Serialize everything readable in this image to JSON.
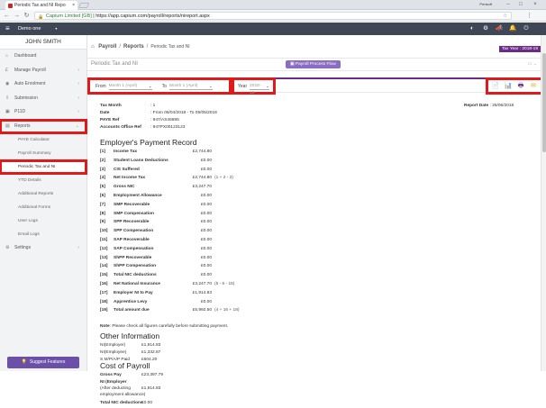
{
  "browser": {
    "tab_title": "Periodic Tax and NI Repo",
    "profile": "Pensoft",
    "url_secure": "Capium Limited [GB]",
    "url_path": "https://app.capium.com/payroll/reports/nireport.aspx"
  },
  "app": {
    "company": "Demo one",
    "tax_year": "Tax Year : 2018-19"
  },
  "sidebar": {
    "username": "JOHN SMITH",
    "items": [
      {
        "label": "Dashboard",
        "icon": "dashboard-icon"
      },
      {
        "label": "Manage Payroll",
        "icon": "payroll-icon"
      },
      {
        "label": "Auto Enrolment",
        "icon": "enrolment-icon"
      },
      {
        "label": "Submission",
        "icon": "submission-icon"
      },
      {
        "label": "P11D",
        "icon": "p11d-icon"
      },
      {
        "label": "Reports",
        "icon": "reports-icon"
      }
    ],
    "sub_items": [
      "PAYE Calculator",
      "Payroll Summary",
      "Periodic Tax and NI",
      "YTD Details",
      "Additional Reports",
      "Additional Forms",
      "User Logs",
      "Email Logs"
    ],
    "settings": "Settings",
    "suggest": "Suggest Features"
  },
  "header": {
    "crumb_payroll": "Payroll",
    "crumb_reports": "Reports",
    "crumb_current": "Periodic Tax and NI",
    "page_title": "Periodic Tax and NI",
    "process_flow": "Payroll Process Flow"
  },
  "filters": {
    "from_label": "From",
    "from_value": "Month 1 (April)",
    "to_label": "To",
    "to_value": "Month 1 (April)",
    "year_label": "Year",
    "year_value": "2018-19"
  },
  "report": {
    "tax_month_label": "Tax Month",
    "tax_month": "1",
    "date_label": "Date",
    "date_value": "From 06/04/2018 - To 05/05/2018",
    "paye_label": "PAYE Ref",
    "paye_value": "947/AS45695",
    "aor_label": "Accounts Office Ref",
    "aor_value": "947PX00123123",
    "report_date_label": "Report Date",
    "report_date": "25/06/2018",
    "epr_title": "Employer's Payment Record",
    "rows": [
      {
        "num": "[1]",
        "label": "Income Tax",
        "value": "£2,744.80",
        "note": ""
      },
      {
        "num": "[2]",
        "label": "Student Loans Deductions",
        "value": "£0.00",
        "note": ""
      },
      {
        "num": "[3]",
        "label": "CIS Suffered",
        "value": "£0.00",
        "note": ""
      },
      {
        "num": "[4]",
        "label": "Net Income Tax",
        "value": "£2,744.80",
        "note": "(1 + 2 - 3)"
      },
      {
        "num": "[5]",
        "label": "Gross NIC",
        "value": "£3,247.70",
        "note": ""
      },
      {
        "num": "[6]",
        "label": "Employment Allowance",
        "value": "£0.00",
        "note": ""
      },
      {
        "num": "[7]",
        "label": "SMP Recoverable",
        "value": "£0.00",
        "note": ""
      },
      {
        "num": "[8]",
        "label": "SMP Compensation",
        "value": "£0.00",
        "note": ""
      },
      {
        "num": "[9]",
        "label": "SPP Recoverable",
        "value": "£0.00",
        "note": ""
      },
      {
        "num": "[10]",
        "label": "SPP Compensation",
        "value": "£0.00",
        "note": ""
      },
      {
        "num": "[11]",
        "label": "SAP Recoverable",
        "value": "£0.00",
        "note": ""
      },
      {
        "num": "[12]",
        "label": "SAP Compensation",
        "value": "£0.00",
        "note": ""
      },
      {
        "num": "[13]",
        "label": "ShPP Recoverable",
        "value": "£0.00",
        "note": ""
      },
      {
        "num": "[14]",
        "label": "ShPP Compensation",
        "value": "£0.00",
        "note": ""
      },
      {
        "num": "[15]",
        "label": "Total NIC deductions",
        "value": "£0.00",
        "note": ""
      },
      {
        "num": "[16]",
        "label": "Net National Insurance",
        "value": "£3,247.70",
        "note": "(5 - 6 - 15)"
      },
      {
        "num": "[17]",
        "label": "Employer NI to Pay",
        "value": "£1,914.83",
        "note": ""
      },
      {
        "num": "[18]",
        "label": "Apprentice Levy",
        "value": "£0.00",
        "note": ""
      },
      {
        "num": "[19]",
        "label": "Total amount due",
        "value": "£5,992.50",
        "note": "(4 + 16 + 18)"
      }
    ],
    "note_bold": "Note",
    "note_text": ": Please check all figures carefully before submitting payment.",
    "other_title": "Other Information",
    "other": [
      {
        "label": "NI(Employer)",
        "value": "£1,914.83"
      },
      {
        "label": "NI(Employee)",
        "value": "£1,332.87"
      },
      {
        "label": "S M/P/A/P Paid",
        "value": "£604.20"
      }
    ],
    "cost_title": "Cost of Payroll",
    "cost": [
      {
        "label": "Gross Pay",
        "value": "£23,397.79"
      },
      {
        "label": "NI (Employer",
        "value": ""
      },
      {
        "label": "(After deducting",
        "value": "£1,914.83"
      },
      {
        "label": "employment allowance)",
        "value": ""
      },
      {
        "label": "Total NIC deductions",
        "value": "£0.00"
      }
    ]
  },
  "colors": {
    "accent": "#6a2c86",
    "highlight": "#e01919",
    "appbar": "#3f4756"
  }
}
